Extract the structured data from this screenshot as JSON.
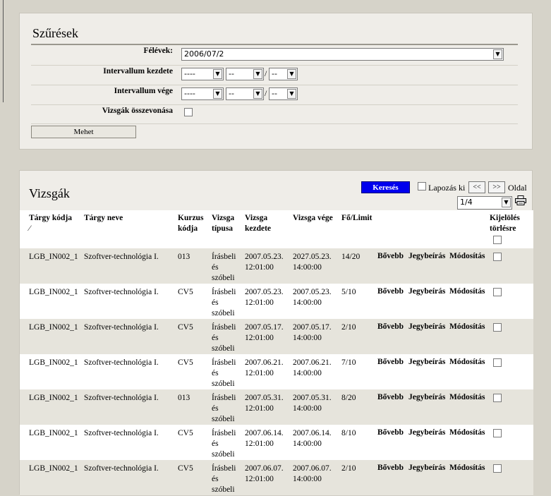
{
  "filter": {
    "title": "Szűrések",
    "semester_label": "Félévek:",
    "semester_value": "2006/07/2",
    "interval_start_label": "Intervallum kezdete",
    "interval_end_label": "Intervallum vége",
    "year_placeholder": "----",
    "part_placeholder": "--",
    "merge_label": "Vizsgák összevonása",
    "go_label": "Mehet"
  },
  "exams": {
    "title": "Vizsgák",
    "search_label": "Keresés",
    "paging_off_label": "Lapozás ki",
    "prev_label": "<<",
    "next_label": ">>",
    "page_label": "Oldal",
    "page_value": "1/4",
    "columns": {
      "code": "Tárgy kódja",
      "sort_mark": "⁄",
      "name": "Tárgy neve",
      "course_1": "Kurzus",
      "course_2": "kódja",
      "type_1": "Vizsga",
      "type_2": "típusa",
      "start_1": "Vizsga",
      "start_2": "kezdete",
      "end": "Vizsga vége",
      "limit": "Fő/Limit",
      "select_1": "Kijelölés",
      "select_2": "törlésre"
    },
    "actions": {
      "more": "Bővebb",
      "grade": "Jegybeírás",
      "edit": "Módosítás"
    },
    "rows": [
      {
        "code": "LGB_IN002_1",
        "name": "Szoftver-technológia I.",
        "course": "013",
        "type_1": "Írásbeli",
        "type_2": "és",
        "type_3": "szóbeli",
        "start_date": "2007.05.23.",
        "start_time": "12:01:00",
        "end_date": "2027.05.23.",
        "end_time": "14:00:00",
        "limit": "14/20"
      },
      {
        "code": "LGB_IN002_1",
        "name": "Szoftver-technológia I.",
        "course": "CV5",
        "type_1": "Írásbeli",
        "type_2": "és",
        "type_3": "szóbeli",
        "start_date": "2007.05.23.",
        "start_time": "12:01:00",
        "end_date": "2007.05.23.",
        "end_time": "14:00:00",
        "limit": "5/10"
      },
      {
        "code": "LGB_IN002_1",
        "name": "Szoftver-technológia I.",
        "course": "CV5",
        "type_1": "Írásbeli",
        "type_2": "és",
        "type_3": "szóbeli",
        "start_date": "2007.05.17.",
        "start_time": "12:01:00",
        "end_date": "2007.05.17.",
        "end_time": "14:00:00",
        "limit": "2/10"
      },
      {
        "code": "LGB_IN002_1",
        "name": "Szoftver-technológia I.",
        "course": "CV5",
        "type_1": "Írásbeli",
        "type_2": "és",
        "type_3": "szóbeli",
        "start_date": "2007.06.21.",
        "start_time": "12:01:00",
        "end_date": "2007.06.21.",
        "end_time": "14:00:00",
        "limit": "7/10"
      },
      {
        "code": "LGB_IN002_1",
        "name": "Szoftver-technológia I.",
        "course": "013",
        "type_1": "Írásbeli",
        "type_2": "és",
        "type_3": "szóbeli",
        "start_date": "2007.05.31.",
        "start_time": "12:01:00",
        "end_date": "2007.05.31.",
        "end_time": "14:00:00",
        "limit": "8/20"
      },
      {
        "code": "LGB_IN002_1",
        "name": "Szoftver-technológia I.",
        "course": "CV5",
        "type_1": "Írásbeli",
        "type_2": "és",
        "type_3": "szóbeli",
        "start_date": "2007.06.14.",
        "start_time": "12:01:00",
        "end_date": "2007.06.14.",
        "end_time": "14:00:00",
        "limit": "8/10"
      },
      {
        "code": "LGB_IN002_1",
        "name": "Szoftver-technológia I.",
        "course": "CV5",
        "type_1": "Írásbeli",
        "type_2": "és",
        "type_3": "szóbeli",
        "start_date": "2007.06.07.",
        "start_time": "12:01:00",
        "end_date": "2007.06.07.",
        "end_time": "14:00:00",
        "limit": "2/10"
      }
    ]
  }
}
